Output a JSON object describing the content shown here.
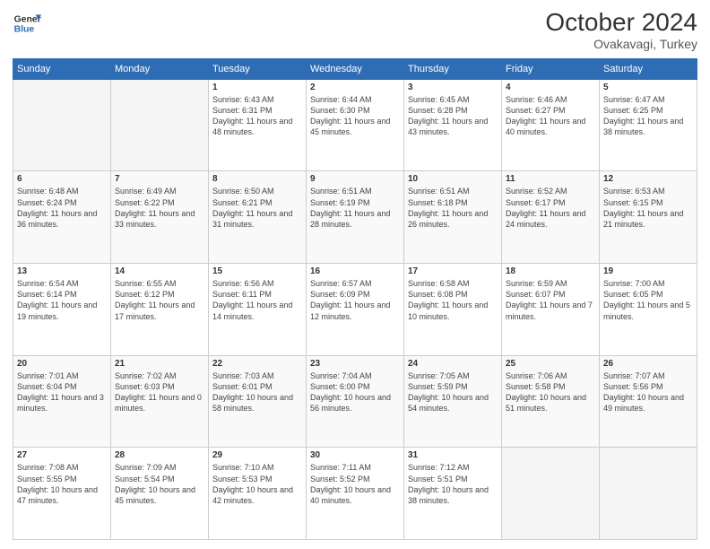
{
  "logo": {
    "line1": "General",
    "line2": "Blue"
  },
  "title": "October 2024",
  "location": "Ovakavagi, Turkey",
  "days_of_week": [
    "Sunday",
    "Monday",
    "Tuesday",
    "Wednesday",
    "Thursday",
    "Friday",
    "Saturday"
  ],
  "weeks": [
    [
      {
        "day": "",
        "info": ""
      },
      {
        "day": "",
        "info": ""
      },
      {
        "day": "1",
        "info": "Sunrise: 6:43 AM\nSunset: 6:31 PM\nDaylight: 11 hours and 48 minutes."
      },
      {
        "day": "2",
        "info": "Sunrise: 6:44 AM\nSunset: 6:30 PM\nDaylight: 11 hours and 45 minutes."
      },
      {
        "day": "3",
        "info": "Sunrise: 6:45 AM\nSunset: 6:28 PM\nDaylight: 11 hours and 43 minutes."
      },
      {
        "day": "4",
        "info": "Sunrise: 6:46 AM\nSunset: 6:27 PM\nDaylight: 11 hours and 40 minutes."
      },
      {
        "day": "5",
        "info": "Sunrise: 6:47 AM\nSunset: 6:25 PM\nDaylight: 11 hours and 38 minutes."
      }
    ],
    [
      {
        "day": "6",
        "info": "Sunrise: 6:48 AM\nSunset: 6:24 PM\nDaylight: 11 hours and 36 minutes."
      },
      {
        "day": "7",
        "info": "Sunrise: 6:49 AM\nSunset: 6:22 PM\nDaylight: 11 hours and 33 minutes."
      },
      {
        "day": "8",
        "info": "Sunrise: 6:50 AM\nSunset: 6:21 PM\nDaylight: 11 hours and 31 minutes."
      },
      {
        "day": "9",
        "info": "Sunrise: 6:51 AM\nSunset: 6:19 PM\nDaylight: 11 hours and 28 minutes."
      },
      {
        "day": "10",
        "info": "Sunrise: 6:51 AM\nSunset: 6:18 PM\nDaylight: 11 hours and 26 minutes."
      },
      {
        "day": "11",
        "info": "Sunrise: 6:52 AM\nSunset: 6:17 PM\nDaylight: 11 hours and 24 minutes."
      },
      {
        "day": "12",
        "info": "Sunrise: 6:53 AM\nSunset: 6:15 PM\nDaylight: 11 hours and 21 minutes."
      }
    ],
    [
      {
        "day": "13",
        "info": "Sunrise: 6:54 AM\nSunset: 6:14 PM\nDaylight: 11 hours and 19 minutes."
      },
      {
        "day": "14",
        "info": "Sunrise: 6:55 AM\nSunset: 6:12 PM\nDaylight: 11 hours and 17 minutes."
      },
      {
        "day": "15",
        "info": "Sunrise: 6:56 AM\nSunset: 6:11 PM\nDaylight: 11 hours and 14 minutes."
      },
      {
        "day": "16",
        "info": "Sunrise: 6:57 AM\nSunset: 6:09 PM\nDaylight: 11 hours and 12 minutes."
      },
      {
        "day": "17",
        "info": "Sunrise: 6:58 AM\nSunset: 6:08 PM\nDaylight: 11 hours and 10 minutes."
      },
      {
        "day": "18",
        "info": "Sunrise: 6:59 AM\nSunset: 6:07 PM\nDaylight: 11 hours and 7 minutes."
      },
      {
        "day": "19",
        "info": "Sunrise: 7:00 AM\nSunset: 6:05 PM\nDaylight: 11 hours and 5 minutes."
      }
    ],
    [
      {
        "day": "20",
        "info": "Sunrise: 7:01 AM\nSunset: 6:04 PM\nDaylight: 11 hours and 3 minutes."
      },
      {
        "day": "21",
        "info": "Sunrise: 7:02 AM\nSunset: 6:03 PM\nDaylight: 11 hours and 0 minutes."
      },
      {
        "day": "22",
        "info": "Sunrise: 7:03 AM\nSunset: 6:01 PM\nDaylight: 10 hours and 58 minutes."
      },
      {
        "day": "23",
        "info": "Sunrise: 7:04 AM\nSunset: 6:00 PM\nDaylight: 10 hours and 56 minutes."
      },
      {
        "day": "24",
        "info": "Sunrise: 7:05 AM\nSunset: 5:59 PM\nDaylight: 10 hours and 54 minutes."
      },
      {
        "day": "25",
        "info": "Sunrise: 7:06 AM\nSunset: 5:58 PM\nDaylight: 10 hours and 51 minutes."
      },
      {
        "day": "26",
        "info": "Sunrise: 7:07 AM\nSunset: 5:56 PM\nDaylight: 10 hours and 49 minutes."
      }
    ],
    [
      {
        "day": "27",
        "info": "Sunrise: 7:08 AM\nSunset: 5:55 PM\nDaylight: 10 hours and 47 minutes."
      },
      {
        "day": "28",
        "info": "Sunrise: 7:09 AM\nSunset: 5:54 PM\nDaylight: 10 hours and 45 minutes."
      },
      {
        "day": "29",
        "info": "Sunrise: 7:10 AM\nSunset: 5:53 PM\nDaylight: 10 hours and 42 minutes."
      },
      {
        "day": "30",
        "info": "Sunrise: 7:11 AM\nSunset: 5:52 PM\nDaylight: 10 hours and 40 minutes."
      },
      {
        "day": "31",
        "info": "Sunrise: 7:12 AM\nSunset: 5:51 PM\nDaylight: 10 hours and 38 minutes."
      },
      {
        "day": "",
        "info": ""
      },
      {
        "day": "",
        "info": ""
      }
    ]
  ]
}
